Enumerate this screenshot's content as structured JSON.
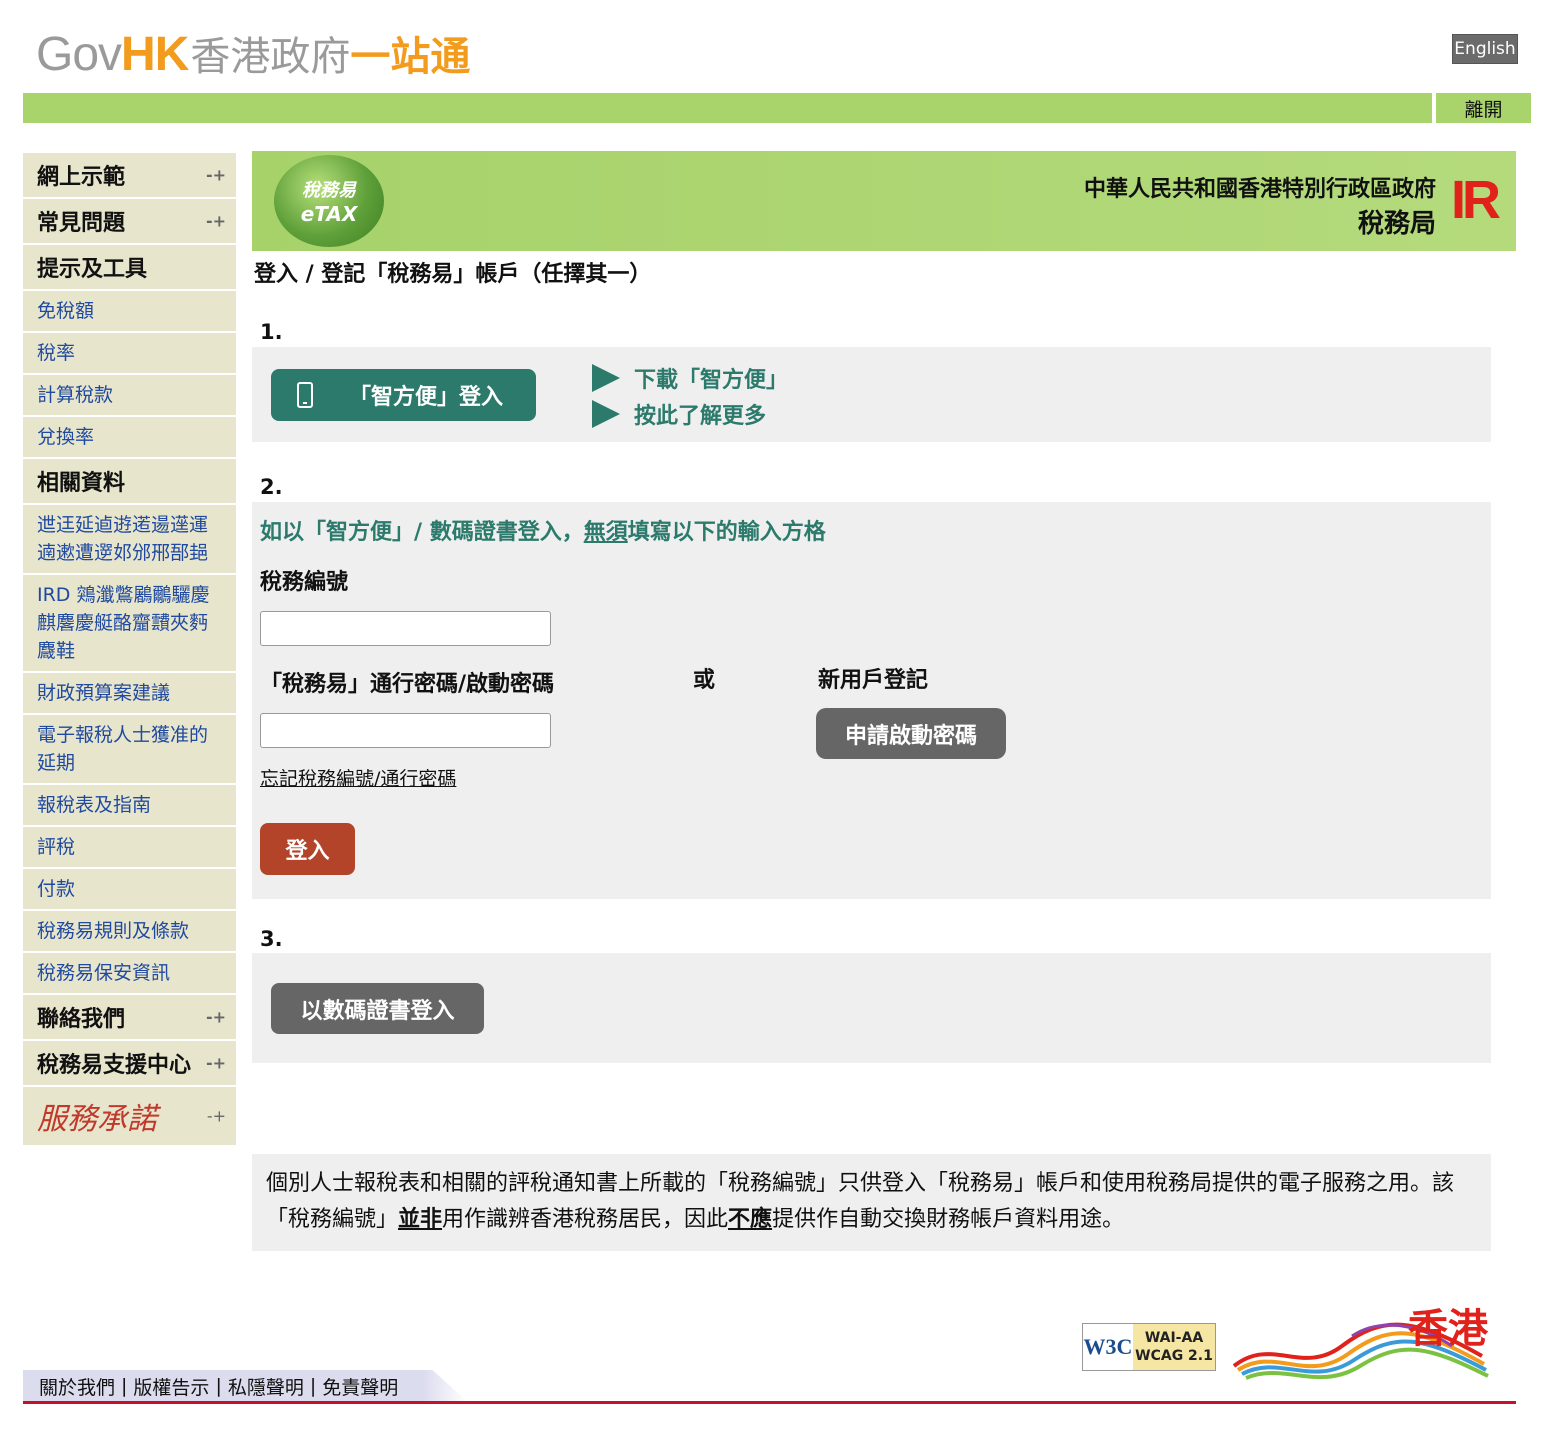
{
  "header": {
    "logo_gov": "Gov",
    "logo_hk": "HK",
    "logo_zh_grey": "香港政府",
    "logo_zh_orange": "一站通",
    "lang_button": "English",
    "exit_button": "離開"
  },
  "sidebar": {
    "items": [
      {
        "label": "網上示範",
        "type": "head",
        "expand": true
      },
      {
        "label": "常見問題",
        "type": "head",
        "expand": true
      },
      {
        "label": "提示及工具",
        "type": "head",
        "expand": false
      },
      {
        "label": "免稅額",
        "type": "link"
      },
      {
        "label": "稅率",
        "type": "link"
      },
      {
        "label": "計算稅款",
        "type": "link"
      },
      {
        "label": "兌換率",
        "type": "link"
      },
      {
        "label": "相關資料",
        "type": "head",
        "expand": false
      },
      {
        "label": "迣迋延逌逰逽逿遳運遖遬遭遻邚邠郉郚郌",
        "type": "link"
      },
      {
        "label": "IRD 鶟瀸鷩鷵鸍驪慶麒麐慶艇酪齏靅夾麪麙鞋",
        "type": "link"
      },
      {
        "label": "財政預算案建議",
        "type": "link"
      },
      {
        "label": "電子報稅人士獲准的延期",
        "type": "link"
      },
      {
        "label": "報稅表及指南",
        "type": "link"
      },
      {
        "label": "評稅",
        "type": "link"
      },
      {
        "label": "付款",
        "type": "link"
      },
      {
        "label": "稅務易規則及條款",
        "type": "link"
      },
      {
        "label": "稅務易保安資訊",
        "type": "link"
      },
      {
        "label": "聯絡我們",
        "type": "head",
        "expand": true
      },
      {
        "label": "稅務易支援中心",
        "type": "head",
        "expand": true
      }
    ],
    "pledge_label": "服務承諾",
    "expand_glyph": "-+"
  },
  "banner": {
    "etax_zh": "稅務易",
    "etax_en": "eTAX",
    "ird_line1": "中華人民共和國香港特別行政區政府",
    "ird_line2": "稅務局",
    "ird_logo": "IR"
  },
  "main": {
    "heading": "登入 / 登記「稅務易」帳戶（任擇其一）",
    "step1": {
      "number": "1.",
      "iam_button": "「智方便」登入",
      "download_link": "下載「智方便」",
      "learn_more_link": "按此了解更多"
    },
    "step2": {
      "number": "2.",
      "note_pre": "如以「智方便」/ 數碼證書登入，",
      "note_underline": "無須",
      "note_post": "填寫以下的輸入方格",
      "tax_file_label": "稅務編號",
      "tax_file_value": "",
      "password_label": "「稅務易」通行密碼/啟動密碼",
      "password_value": "",
      "or_label": "或",
      "new_user_label": "新用戶登記",
      "activate_button": "申請啟動密碼",
      "forgot_link": "忘記稅務編號/通行密碼",
      "login_button": "登入"
    },
    "step3": {
      "number": "3.",
      "cert_button": "以數碼證書登入"
    }
  },
  "notice": {
    "part1": "個別人士報稅表和相關的評稅通知書上所載的「稅務編號」只供登入「稅務易」帳戶和使用稅務局提供的電子服務之用。該「稅務編號」",
    "bold1": "並非",
    "part2": "用作識辨香港稅務居民，因此",
    "bold2": "不應",
    "part3": "提供作自動交換財務帳戶資料用途。"
  },
  "footer": {
    "links": [
      "關於我們",
      "版權告示",
      "私隱聲明",
      "免責聲明"
    ],
    "separator": "|",
    "w3c": "W3C",
    "wai": "WAI-AA",
    "wcag": "WCAG 2.1",
    "brand_zh": "香港"
  },
  "colors": {
    "green_bar": "#a9d46b",
    "teal": "#2b7a6c",
    "login_red": "#b3442a",
    "grey_button": "#666666",
    "panel_bg": "#efefef",
    "sidebar_bg": "#e8e5cd",
    "link_blue": "#1f4aa0",
    "footer_red": "#c8102e"
  }
}
